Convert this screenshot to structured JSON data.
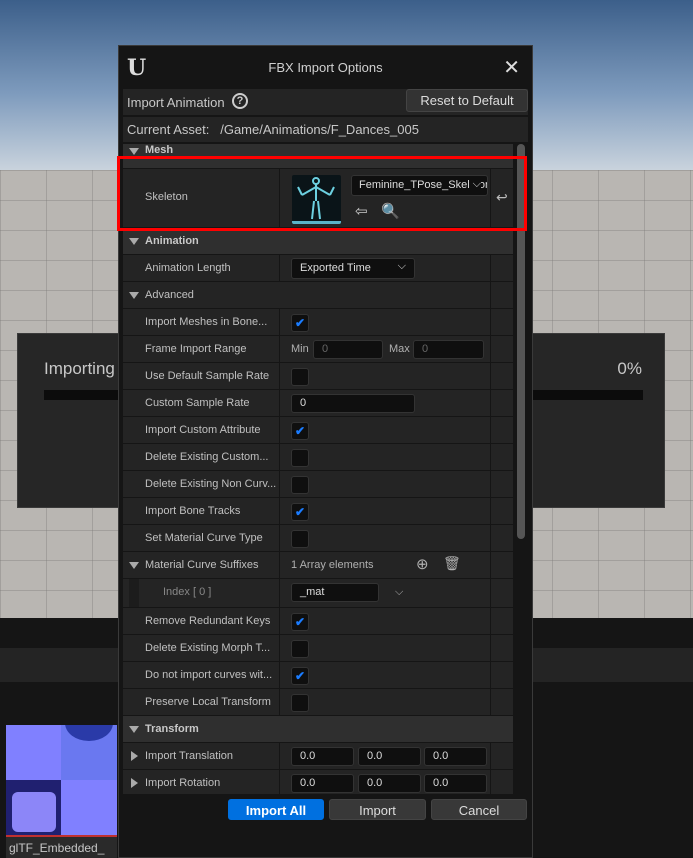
{
  "background": {
    "progress_title": "Importing",
    "progress_percent": "0%",
    "progress_value": 0,
    "thumbnail_label": "glTF_Embedded_"
  },
  "dialog": {
    "title": "FBX Import Options",
    "close_icon": "close-icon",
    "header_label": "Import Animation",
    "reset_label": "Reset to Default",
    "current_asset_label": "Current Asset:",
    "current_asset_value": "/Game/Animations/F_Dances_005"
  },
  "sections": {
    "mesh": "Mesh",
    "skeleton_label": "Skeleton",
    "skeleton_value": "Feminine_TPose_Skeleton",
    "animation": "Animation",
    "animation_length_label": "Animation Length",
    "animation_length_value": "Exported Time",
    "advanced": "Advanced",
    "rows": [
      {
        "label": "Import Meshes in Bone...",
        "checked": true
      },
      {
        "label": "Frame Import Range",
        "type": "range",
        "min_label": "Min",
        "min": "0",
        "max_label": "Max",
        "max": "0"
      },
      {
        "label": "Use Default Sample Rate",
        "checked": false
      },
      {
        "label": "Custom Sample Rate",
        "type": "text",
        "value": "0"
      },
      {
        "label": "Import Custom Attribute",
        "checked": true
      },
      {
        "label": "Delete Existing Custom...",
        "checked": false
      },
      {
        "label": "Delete Existing Non Curv...",
        "checked": false
      },
      {
        "label": "Import Bone Tracks",
        "checked": true
      },
      {
        "label": "Set Material Curve Type",
        "checked": false
      }
    ],
    "suffixes_label": "Material Curve Suffixes",
    "suffixes_count": "1 Array elements",
    "index_label": "Index [ 0 ]",
    "index_value": "_mat",
    "rows2": [
      {
        "label": "Remove Redundant Keys",
        "checked": true
      },
      {
        "label": "Delete Existing Morph T...",
        "checked": false
      },
      {
        "label": "Do not import curves wit...",
        "checked": true
      },
      {
        "label": "Preserve Local Transform",
        "checked": false
      }
    ],
    "transform": "Transform",
    "translation_label": "Import Translation",
    "translation": [
      "0.0",
      "0.0",
      "0.0"
    ],
    "rotation_label": "Import Rotation",
    "rotation": [
      "0.0",
      "0.0",
      "0.0"
    ]
  },
  "buttons": {
    "import_all": "Import All",
    "import": "Import",
    "cancel": "Cancel"
  },
  "colors": {
    "accent": "#0070e0",
    "highlight": "#ff0000",
    "check": "#1a7cff"
  }
}
